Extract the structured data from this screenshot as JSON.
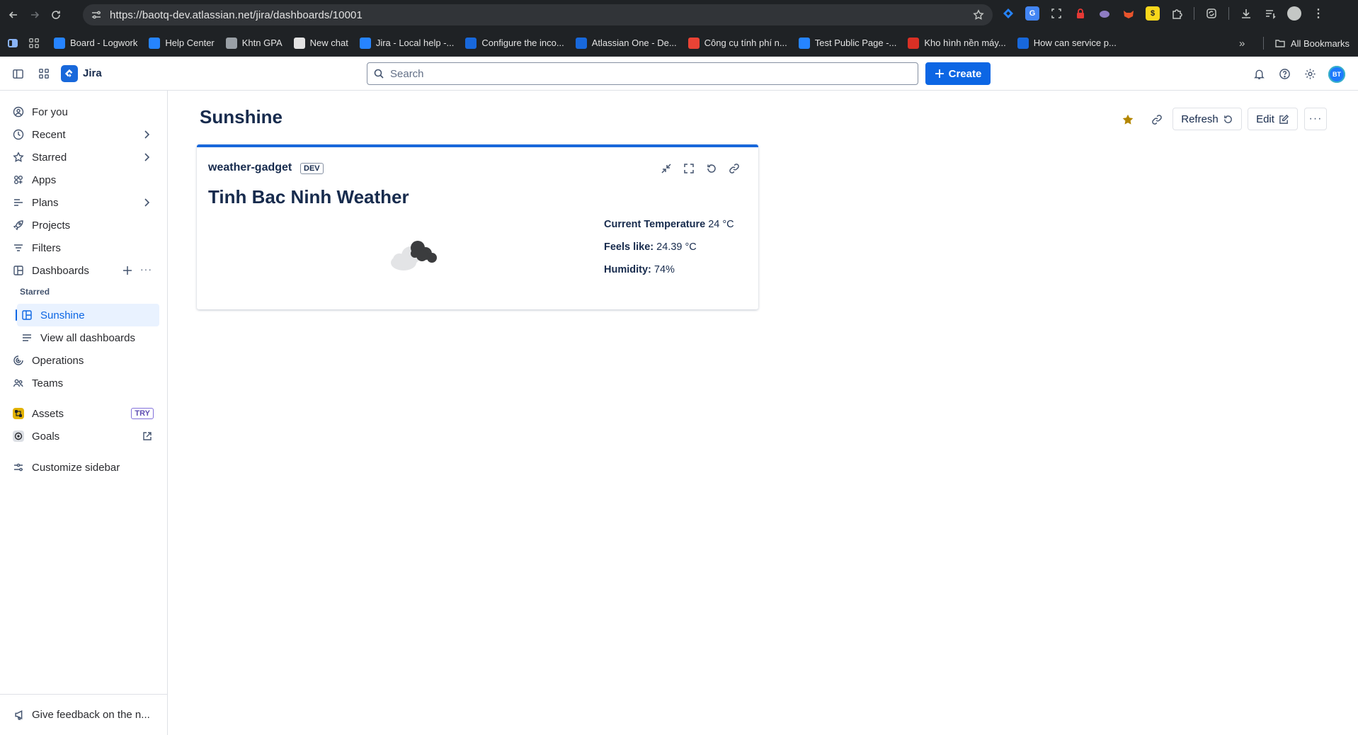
{
  "browser": {
    "url": "https://baotq-dev.atlassian.net/jira/dashboards/10001",
    "bookmarks": [
      {
        "label": "Board - Logwork",
        "color": "#2684ff"
      },
      {
        "label": "Help Center",
        "color": "#2684ff"
      },
      {
        "label": "Khtn GPA",
        "color": "#9aa0a6"
      },
      {
        "label": "New chat",
        "color": "#e3e3e3"
      },
      {
        "label": "Jira - Local help -...",
        "color": "#2684ff"
      },
      {
        "label": "Configure the inco...",
        "color": "#1868db"
      },
      {
        "label": "Atlassian One - De...",
        "color": "#1868db"
      },
      {
        "label": "Công cụ tính phí n...",
        "color": "#ea4335"
      },
      {
        "label": "Test Public Page -...",
        "color": "#2684ff"
      },
      {
        "label": "Kho hình nền máy...",
        "color": "#d93025"
      },
      {
        "label": "How can service p...",
        "color": "#1868db"
      }
    ],
    "all_bookmarks_label": "All Bookmarks"
  },
  "topnav": {
    "app_name": "Jira",
    "search_placeholder": "Search",
    "create_label": "Create",
    "avatar_initials": "BT"
  },
  "sidebar": {
    "items": [
      {
        "label": "For you",
        "icon": "person-circle-icon"
      },
      {
        "label": "Recent",
        "icon": "clock-icon"
      },
      {
        "label": "Starred",
        "icon": "star-icon"
      },
      {
        "label": "Apps",
        "icon": "apps-icon"
      },
      {
        "label": "Plans",
        "icon": "plans-icon"
      },
      {
        "label": "Projects",
        "icon": "rocket-icon"
      },
      {
        "label": "Filters",
        "icon": "filter-icon"
      },
      {
        "label": "Dashboards",
        "icon": "dashboard-icon"
      }
    ],
    "starred_heading": "Starred",
    "starred_dashboard": "Sunshine",
    "view_all_dashboards": "View all dashboards",
    "operations": "Operations",
    "teams": "Teams",
    "assets": "Assets",
    "assets_badge": "TRY",
    "goals": "Goals",
    "customize": "Customize sidebar",
    "feedback": "Give feedback on the n..."
  },
  "dashboard": {
    "title": "Sunshine",
    "refresh_label": "Refresh",
    "edit_label": "Edit",
    "starred": true,
    "star_color": "#b38600",
    "accent": "#0c66e4"
  },
  "gadget": {
    "name": "weather-gadget",
    "badge": "DEV",
    "heading": "Tinh Bac Ninh Weather",
    "weather_icon": "cloudy-icon",
    "current_temp_label": "Current Temperature",
    "current_temp_value": "24 °C",
    "feels_like_label": "Feels like:",
    "feels_like_value": "24.39 °C",
    "humidity_label": "Humidity:",
    "humidity_value": "74%"
  }
}
